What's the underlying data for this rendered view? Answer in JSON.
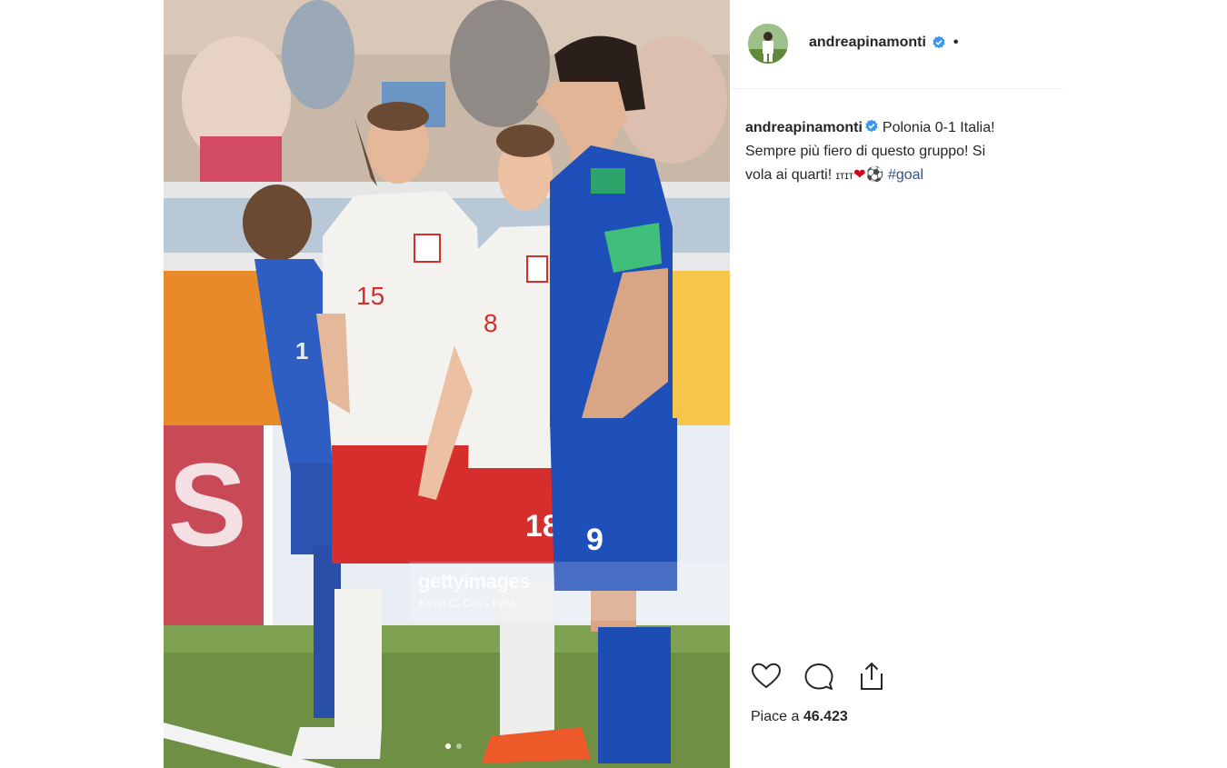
{
  "post": {
    "username": "andreapinamonti",
    "separator": "•",
    "caption": {
      "username": "andreapinamonti",
      "line1": "Polonia 0-1 Italia!",
      "line2": "Sempre più fiero di questo gruppo! Si",
      "line3": "vola ai quarti! ",
      "flag_text": "ɪᴛɪᴛ",
      "heart": "❤",
      "ball": "⚽",
      "hashtag": "#goal"
    },
    "likes_label": "Piace a",
    "likes_count": "46.423"
  },
  "photo": {
    "watermark_brand": "gettyimages",
    "watermark_credit": "Kevin C. Cox - FIFA",
    "jersey_numbers": {
      "main_player": "9",
      "poland_left": "15",
      "poland_right_shirt": "8",
      "poland_right_shorts": "18",
      "italy_left": "1"
    },
    "carousel_dots": 2,
    "active_dot": 0
  },
  "icons": {
    "verified": "verified-badge-icon",
    "like": "heart-icon",
    "comment": "comment-icon",
    "share": "share-icon"
  },
  "colors": {
    "verified_blue": "#3897f0",
    "hashtag": "#385185",
    "italy_blue": "#1f4fb8",
    "poland_red": "#d62d2d",
    "pitch_green": "#6e8f44"
  }
}
